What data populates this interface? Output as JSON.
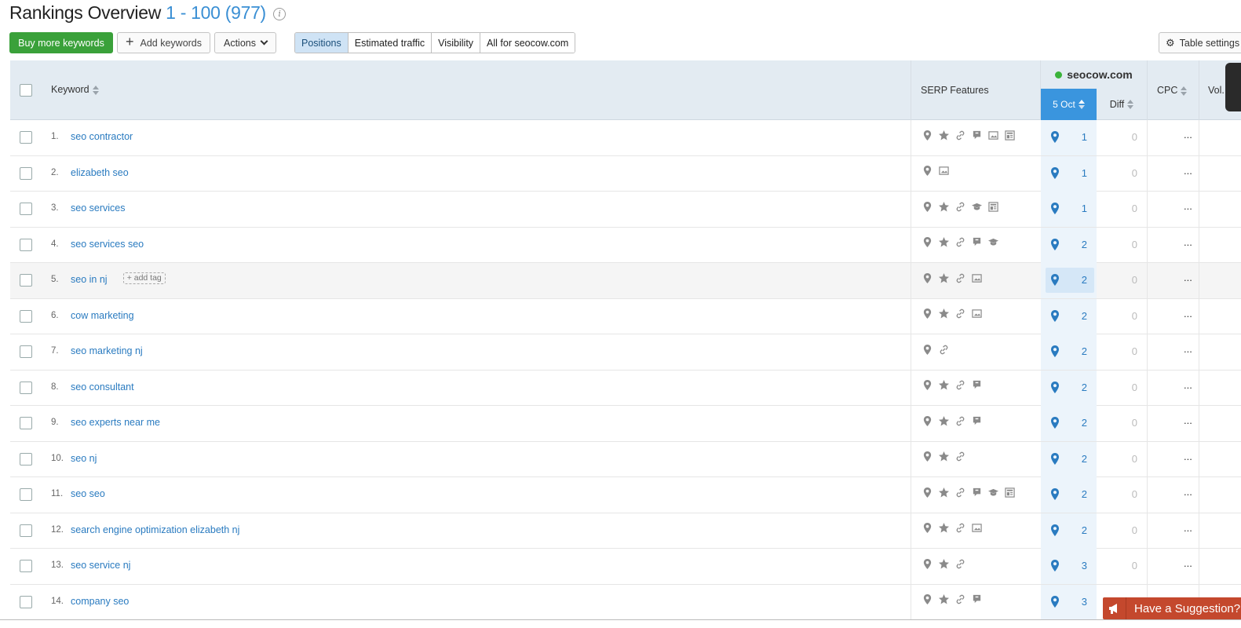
{
  "header": {
    "title": "Rankings Overview",
    "range": "1 - 100 (977)",
    "info_icon": "i"
  },
  "toolbar": {
    "buy_label": "Buy more keywords",
    "add_label": "Add keywords",
    "actions_label": "Actions",
    "segments": [
      "Positions",
      "Estimated traffic",
      "Visibility",
      "All for seocow.com"
    ],
    "active_segment": "Positions",
    "table_settings_label": "Table settings"
  },
  "table": {
    "headers": {
      "keyword": "Keyword",
      "serp": "SERP Features",
      "domain": "seocow.com",
      "date": "5 Oct",
      "diff": "Diff",
      "cpc": "CPC",
      "vol": "Vol."
    },
    "rows": [
      {
        "num": "1.",
        "keyword": "seo contractor",
        "serp": [
          "pin",
          "star",
          "link",
          "review",
          "image",
          "news"
        ],
        "pos": "1",
        "diff": "0",
        "cpc": "..."
      },
      {
        "num": "2.",
        "keyword": "elizabeth seo",
        "serp": [
          "pin",
          "image"
        ],
        "pos": "1",
        "diff": "0",
        "cpc": "..."
      },
      {
        "num": "3.",
        "keyword": "seo services",
        "serp": [
          "pin",
          "star",
          "link",
          "edu",
          "news"
        ],
        "pos": "1",
        "diff": "0",
        "cpc": "..."
      },
      {
        "num": "4.",
        "keyword": "seo services seo",
        "serp": [
          "pin",
          "star",
          "link",
          "review",
          "edu"
        ],
        "pos": "2",
        "diff": "0",
        "cpc": "..."
      },
      {
        "num": "5.",
        "keyword": "seo in nj",
        "tag": "+ add tag",
        "serp": [
          "pin",
          "star",
          "link",
          "image"
        ],
        "pos": "2",
        "diff": "0",
        "cpc": "...",
        "hover": true
      },
      {
        "num": "6.",
        "keyword": "cow marketing",
        "serp": [
          "pin",
          "star",
          "link",
          "image"
        ],
        "pos": "2",
        "diff": "0",
        "cpc": "..."
      },
      {
        "num": "7.",
        "keyword": "seo marketing nj",
        "serp": [
          "pin",
          "link"
        ],
        "pos": "2",
        "diff": "0",
        "cpc": "..."
      },
      {
        "num": "8.",
        "keyword": "seo consultant",
        "serp": [
          "pin",
          "star",
          "link",
          "review"
        ],
        "pos": "2",
        "diff": "0",
        "cpc": "..."
      },
      {
        "num": "9.",
        "keyword": "seo experts near me",
        "serp": [
          "pin",
          "star",
          "link",
          "review"
        ],
        "pos": "2",
        "diff": "0",
        "cpc": "..."
      },
      {
        "num": "10.",
        "keyword": "seo nj",
        "serp": [
          "pin",
          "star",
          "link"
        ],
        "pos": "2",
        "diff": "0",
        "cpc": "..."
      },
      {
        "num": "11.",
        "keyword": "seo seo",
        "serp": [
          "pin",
          "star",
          "link",
          "review",
          "edu",
          "news"
        ],
        "pos": "2",
        "diff": "0",
        "cpc": "..."
      },
      {
        "num": "12.",
        "keyword": "search engine optimization elizabeth nj",
        "serp": [
          "pin",
          "star",
          "link",
          "image"
        ],
        "pos": "2",
        "diff": "0",
        "cpc": "..."
      },
      {
        "num": "13.",
        "keyword": "seo service nj",
        "serp": [
          "pin",
          "star",
          "link"
        ],
        "pos": "3",
        "diff": "0",
        "cpc": "..."
      },
      {
        "num": "14.",
        "keyword": "company seo",
        "serp": [
          "pin",
          "star",
          "link",
          "review"
        ],
        "pos": "3",
        "diff": "",
        "cpc": ""
      }
    ]
  },
  "suggestion": {
    "label": "Have a Suggestion?"
  },
  "colors": {
    "accent": "#3a95de",
    "link": "#2a7bc0",
    "green": "#3aa13a",
    "suggest": "#c4482d"
  }
}
